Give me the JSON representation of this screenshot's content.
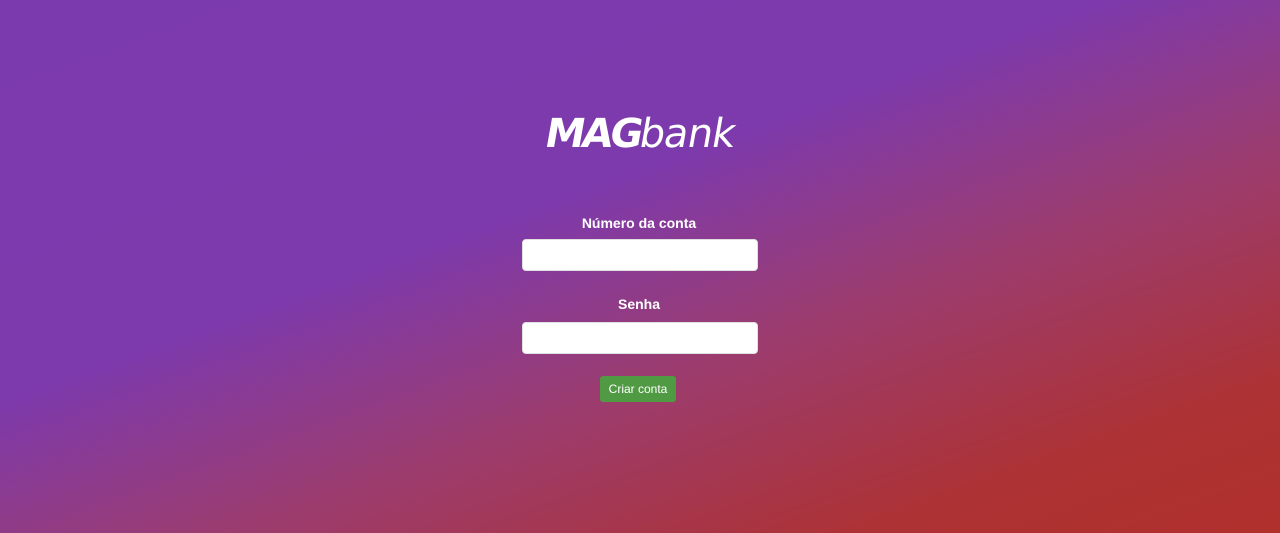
{
  "brand": {
    "logo_bold": "MAG",
    "logo_light": "bank"
  },
  "form": {
    "account_label": "Número da conta",
    "account_value": "",
    "account_placeholder": "",
    "password_label": "Senha",
    "password_value": "",
    "password_placeholder": "",
    "submit_label": "Criar conta"
  },
  "colors": {
    "gradient_start": "#7b3aae",
    "gradient_end": "#b0302c",
    "button": "#4f9a42",
    "text": "#ffffff"
  }
}
